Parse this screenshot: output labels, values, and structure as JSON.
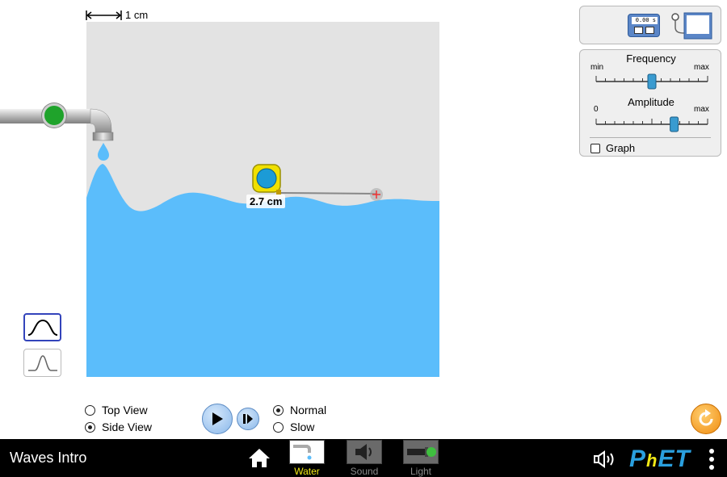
{
  "scale": {
    "label": "1 cm"
  },
  "tape_measure": {
    "readout": "2.7 cm"
  },
  "view_options": [
    {
      "label": "Top View",
      "selected": false
    },
    {
      "label": "Side View",
      "selected": true
    }
  ],
  "speed_options": [
    {
      "label": "Normal",
      "selected": true
    },
    {
      "label": "Slow",
      "selected": false
    }
  ],
  "stopwatch": {
    "readout": "0.00 s"
  },
  "controls": {
    "frequency": {
      "title": "Frequency",
      "min_label": "min",
      "max_label": "max",
      "value": 0.5
    },
    "amplitude": {
      "title": "Amplitude",
      "min_label": "0",
      "max_label": "max",
      "value": 0.7
    },
    "graph": {
      "label": "Graph",
      "checked": false
    }
  },
  "navbar": {
    "sim_title": "Waves Intro",
    "screens": [
      {
        "label": "Water",
        "selected": true
      },
      {
        "label": "Sound",
        "selected": false
      },
      {
        "label": "Light",
        "selected": false
      }
    ],
    "logo": "PhET"
  },
  "colors": {
    "water": "#5bbdfb",
    "tank_background": "#e3e3e3",
    "navbar": "#000000",
    "selected_screen_label": "#f2e916",
    "unselected_screen_label": "#8a8a8a",
    "faucet_button": "#1fa32b",
    "phet_blue": "#2a9fde"
  }
}
